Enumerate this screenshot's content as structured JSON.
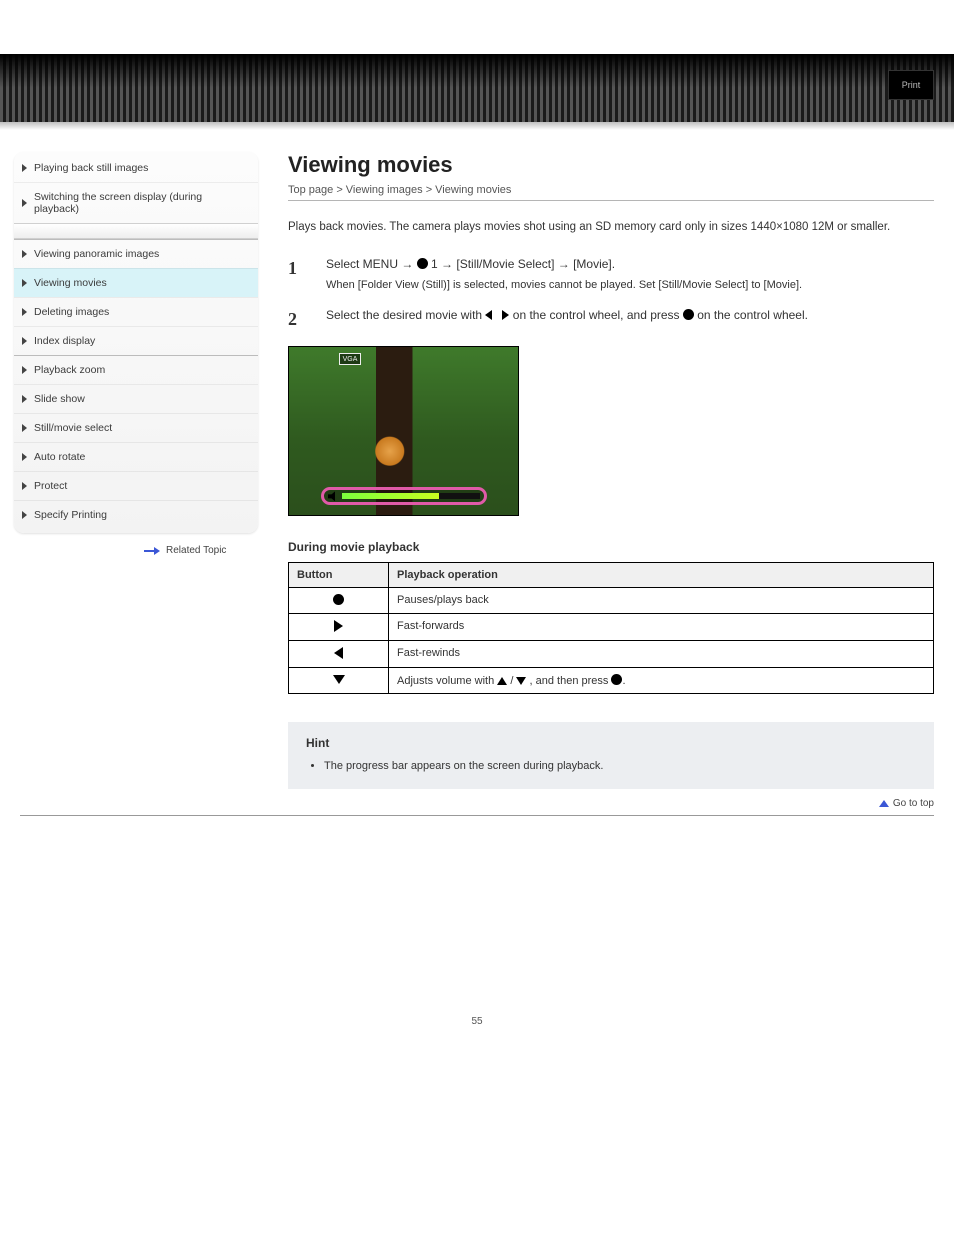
{
  "topbar": {
    "button": "Print"
  },
  "sidebar": {
    "items": [
      {
        "label": "Playing back still images",
        "active": false
      },
      {
        "label": "Switching the screen display (during playback)",
        "active": false
      },
      {
        "label": "Viewing panoramic images",
        "active": false
      },
      {
        "label": "Viewing movies",
        "active": true
      },
      {
        "label": "Deleting images",
        "active": false
      },
      {
        "label": "Index display",
        "active": false
      },
      {
        "label": "Playback zoom",
        "active": false
      },
      {
        "label": "Slide show",
        "active": false
      },
      {
        "label": "Still/movie select",
        "active": false
      },
      {
        "label": "Auto rotate",
        "active": false
      },
      {
        "label": "Protect",
        "active": false
      },
      {
        "label": "Specify Printing",
        "active": false
      }
    ],
    "related_label": "Related Topic"
  },
  "page": {
    "title": "Viewing movies",
    "breadcrumb": "Top page > Viewing images > Viewing movies",
    "intro": "Plays back movies. The camera plays movies shot using an SD memory card only in sizes 1440×1080 12M or smaller.",
    "steps": [
      {
        "num": "1",
        "text_prefix": "Select MENU → ",
        "text_after_icon": " 1 → [Still/Movie Select] → [Movie].",
        "sub": "When [Folder View (Still)] is selected, movies cannot be played. Set [Still/Movie Select] to [Movie]."
      },
      {
        "num": "2",
        "text_prefix": "Select the desired movie with ",
        "text_mid": " on the control wheel, and press ",
        "text_after": " on the control wheel."
      }
    ],
    "vga_label": "VGA",
    "table": {
      "heading": "During movie playback",
      "header_button": "Button",
      "header_op": "Playback operation",
      "rows": [
        {
          "icon": "dot",
          "op": "Pauses/plays back"
        },
        {
          "icon": "tri-right",
          "op": "Fast-forwards"
        },
        {
          "icon": "tri-left",
          "op": "Fast-rewinds"
        },
        {
          "icon": "tri-down",
          "op_prefix": "Adjusts volume with ",
          "op_suffix": ", and then press "
        }
      ]
    },
    "hint": {
      "title": "Hint",
      "items": [
        "The progress bar appears on the screen during playback."
      ]
    },
    "gototop": "Go to top",
    "pagenum": "55"
  }
}
